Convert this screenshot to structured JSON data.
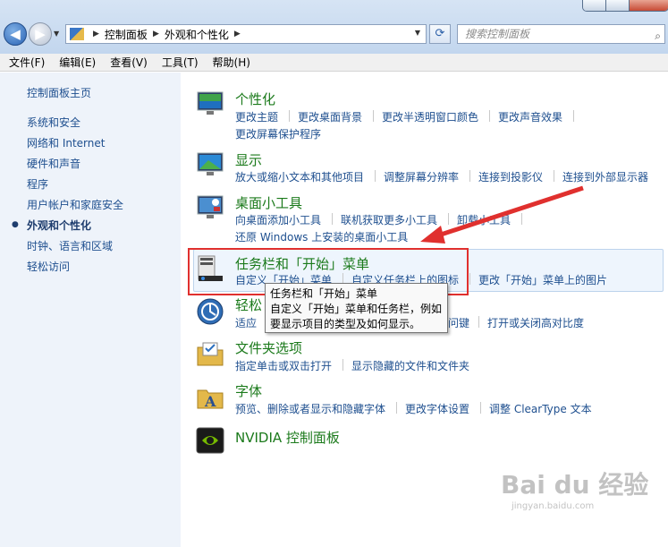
{
  "window": {
    "minimize": "",
    "maximize": "",
    "close": ""
  },
  "nav": {
    "back_glyph": "◀",
    "forward_glyph": "▶",
    "history_glyph": "▼",
    "refresh_glyph": "⟳"
  },
  "address": {
    "crumbs": [
      "控制面板",
      "外观和个性化"
    ],
    "sep_glyph": "▶",
    "drop_glyph": "▼"
  },
  "search": {
    "placeholder": "搜索控制面板",
    "icon": "search-icon",
    "glyph": "⌕"
  },
  "menu": [
    "文件(F)",
    "编辑(E)",
    "查看(V)",
    "工具(T)",
    "帮助(H)"
  ],
  "sidebar": {
    "home": "控制面板主页",
    "items": [
      "系统和安全",
      "网络和 Internet",
      "硬件和声音",
      "程序",
      "用户帐户和家庭安全",
      "外观和个性化",
      "时钟、语言和区域",
      "轻松访问"
    ],
    "active_index": 5,
    "bullet": "●"
  },
  "categories": [
    {
      "title": "个性化",
      "icon": "personalization-icon",
      "links": [
        "更改主题",
        "更改桌面背景",
        "更改半透明窗口颜色",
        "更改声音效果",
        "更改屏幕保护程序"
      ]
    },
    {
      "title": "显示",
      "icon": "display-icon",
      "links": [
        "放大或缩小文本和其他项目",
        "调整屏幕分辨率",
        "连接到投影仪",
        "连接到外部显示器"
      ]
    },
    {
      "title": "桌面小工具",
      "icon": "gadgets-icon",
      "links": [
        "向桌面添加小工具",
        "联机获取更多小工具",
        "卸载小工具",
        "还原 Windows 上安装的桌面小工具"
      ]
    },
    {
      "title": "任务栏和「开始」菜单",
      "icon": "taskbar-icon",
      "links": [
        "自定义「开始」菜单",
        "自定义任务栏上的图标",
        "更改「开始」菜单上的图片"
      ]
    },
    {
      "title": "轻松",
      "icon": "ease-of-access-icon",
      "links": [
        "适应",
        "问键",
        "打开或关闭高对比度"
      ]
    },
    {
      "title": "文件夹选项",
      "icon": "folder-options-icon",
      "links": [
        "指定单击或双击打开",
        "显示隐藏的文件和文件夹"
      ]
    },
    {
      "title": "字体",
      "icon": "fonts-icon",
      "links": [
        "预览、删除或者显示和隐藏字体",
        "更改字体设置",
        "调整 ClearType 文本"
      ]
    },
    {
      "title": "NVIDIA 控制面板",
      "icon": "nvidia-icon",
      "links": []
    }
  ],
  "tooltip": {
    "title": "任务栏和「开始」菜单",
    "lines": [
      "自定义「开始」菜单和任务栏，例如",
      "要显示项目的类型及如何显示。"
    ]
  },
  "watermark": {
    "text": "Bai du 经验",
    "url": "jingyan.baidu.com"
  },
  "colors": {
    "accent_link": "#1e4f8f",
    "category_title": "#1b7a1b",
    "annotation_red": "#e0302e"
  }
}
